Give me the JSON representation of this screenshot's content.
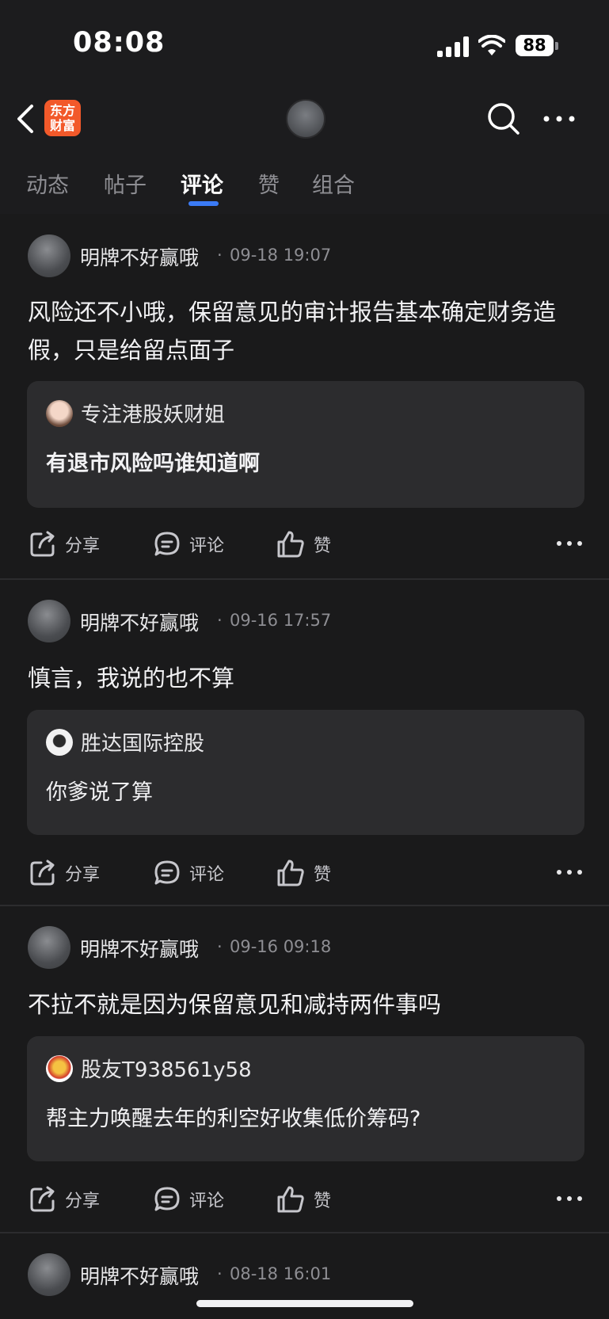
{
  "status_bar": {
    "time": "08:08",
    "battery": "88"
  },
  "nav": {
    "logo_line1": "东方",
    "logo_line2": "财富"
  },
  "tabs": [
    {
      "label": "动态"
    },
    {
      "label": "帖子"
    },
    {
      "label": "评论"
    },
    {
      "label": "赞"
    },
    {
      "label": "组合"
    }
  ],
  "actions": {
    "share": "分享",
    "comment": "评论",
    "like": "赞"
  },
  "comments": [
    {
      "author": "明牌不好赢哦",
      "sep": "·",
      "time": "09-18 19:07",
      "content": "风险还不小哦，保留意见的审计报告基本确定财务造假，只是给留点面子",
      "quote_author": "专注港股妖财姐",
      "quote_text": "有退市风险吗谁知道啊"
    },
    {
      "author": "明牌不好赢哦",
      "sep": "·",
      "time": "09-16 17:57",
      "content": "慎言，我说的也不算",
      "quote_author": "胜达国际控股",
      "quote_text": "你爹说了算"
    },
    {
      "author": "明牌不好赢哦",
      "sep": "·",
      "time": "09-16 09:18",
      "content": "不拉不就是因为保留意见和减持两件事吗",
      "quote_author": "股友T938561y58",
      "quote_text": "帮主力唤醒去年的利空好收集低价筹码?"
    },
    {
      "author": "明牌不好赢哦",
      "sep": "·",
      "time": "08-18 16:01"
    }
  ]
}
